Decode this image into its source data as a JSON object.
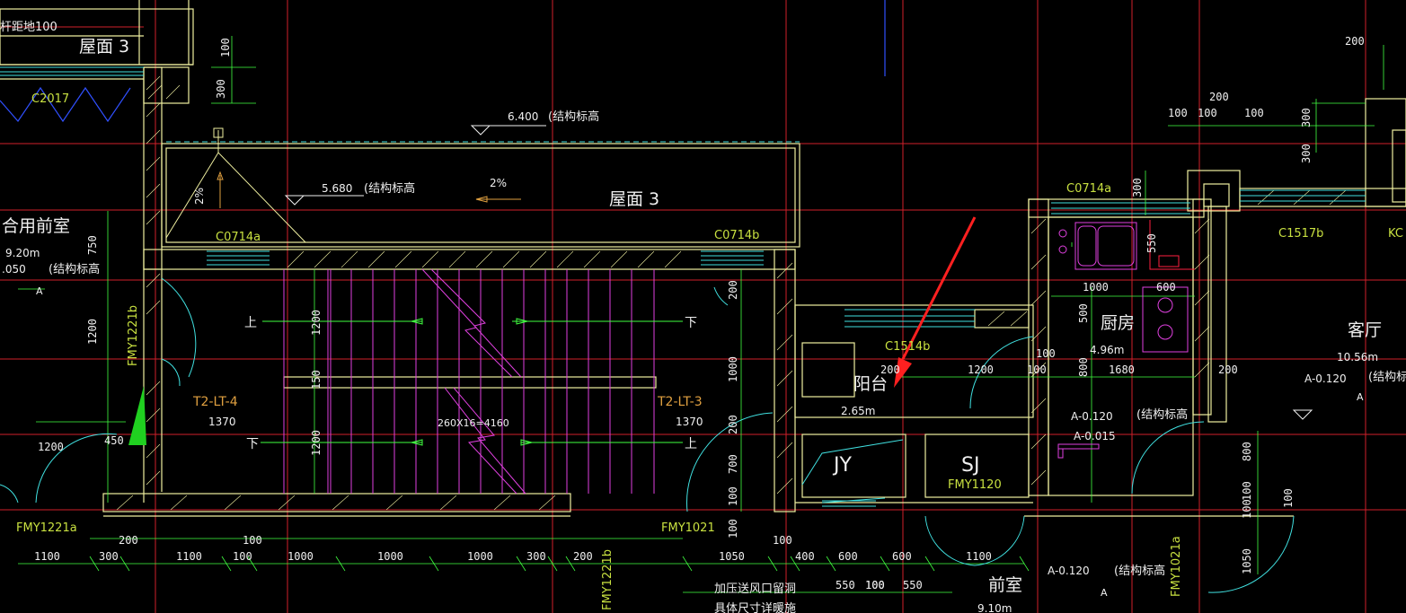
{
  "colors": {
    "background": "#000000",
    "wall": "#f0f0a0",
    "axis": "#d0202a",
    "dimension": "#40ff40",
    "stair": "#e040e0",
    "window": "#40e0e0",
    "annotation_arrow": "#ff2020",
    "white_text": "#f0f0f0",
    "orange_text": "#e0a040",
    "yellow_green_text": "#c8e040"
  },
  "rooms": {
    "roof_left": "屋面 3",
    "roof_main": "屋面 3",
    "shared_lobby": "合用前室",
    "shared_lobby_area": "9.20m",
    "balcony": "阳台",
    "balcony_area": "2.65m",
    "kitchen": "厨房",
    "kitchen_area": "4.96m",
    "living": "客厅",
    "living_area": "10.56m",
    "front_room": "前室",
    "front_room_area": "9.10m",
    "jy": "JY",
    "sj": "SJ"
  },
  "elevations": {
    "roof_top": "6.400",
    "roof_lower": "5.680",
    "struct_note": "(结构标高",
    "kitchen_a": "A-0.120",
    "kitchen_b": "A-0.015",
    "living_a": "A-0.120",
    "front_a": "A-0.120",
    "lobby_elev": ".050",
    "area_mark": "A"
  },
  "slopes": {
    "a": "2%",
    "b": "2%"
  },
  "windows": {
    "c2017": "C2017",
    "c0714a_left": "C0714a",
    "c0714b": "C0714b",
    "c0714a_right": "C0714a",
    "c1514b": "C1514b",
    "c1517b": "C1517b",
    "kc": "KC"
  },
  "doors": {
    "fmy1221b_left": "FMY1221b",
    "fmy1221a": "FMY1221a",
    "fmy1021": "FMY1021",
    "fmy1221b_bottom": "FMY1221b",
    "fmy1120": "FMY1120",
    "fmy1021a": "FMY1021a"
  },
  "stairs": {
    "left_tag": "T2-LT-4",
    "right_tag": "T2-LT-3",
    "left_width": "1370",
    "right_width": "1370",
    "treads": "260X16=4160",
    "up": "上",
    "down": "下"
  },
  "notes": {
    "pressurized_vent": "加压送风口留洞",
    "size_note": "具体尺寸详暖施",
    "balcony_drain_note": "杆距地100"
  },
  "dimensions": {
    "bottom_row": [
      "1100",
      "300",
      "1100",
      "100",
      "1000",
      "1000",
      "1000",
      "300",
      "200",
      "1050",
      "100",
      "400",
      "600",
      "600",
      "1100"
    ],
    "bottom_top_row": [
      "200",
      "100",
      "100"
    ],
    "bottom_lower_row": [
      "550",
      "100",
      "550"
    ],
    "left_vertical": [
      "750",
      "1200",
      "450",
      "1200"
    ],
    "stair_vertical": [
      "1200",
      "150",
      "1200"
    ],
    "top_vertical": [
      "100",
      "300"
    ],
    "mid_vertical": [
      "200",
      "1000",
      "200",
      "700",
      "100",
      "100"
    ],
    "kitchen_dims": [
      "550",
      "1000",
      "600",
      "500",
      "800",
      "100",
      "1200",
      "100",
      "1680",
      "200"
    ],
    "top_right": [
      "200",
      "200",
      "100",
      "100",
      "100",
      "300",
      "300",
      "300",
      "200"
    ],
    "right_vertical": [
      "800",
      "100",
      "100",
      "100",
      "1050"
    ]
  }
}
